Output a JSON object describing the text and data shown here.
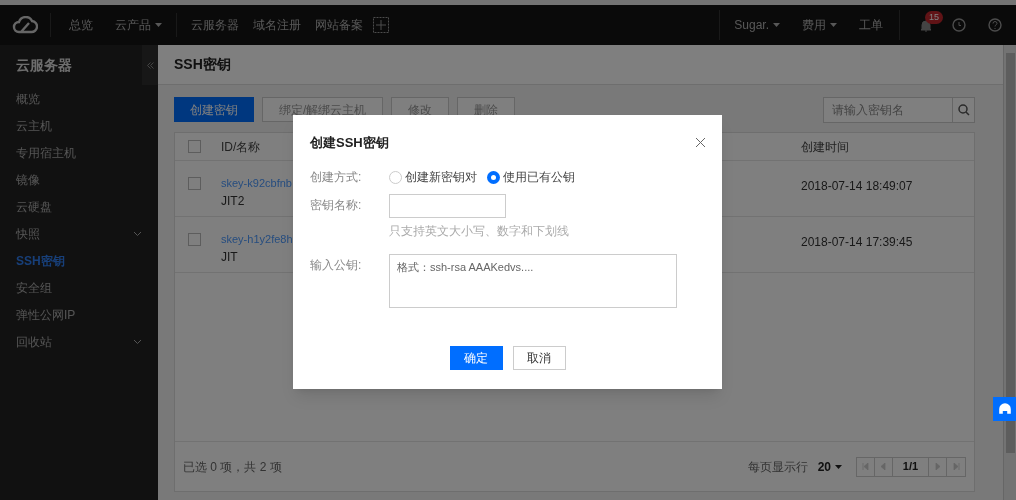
{
  "topnav": {
    "left": [
      {
        "label": "总览",
        "dropdown": false
      },
      {
        "label": "云产品",
        "dropdown": true
      }
    ],
    "shortcuts": [
      "云服务器",
      "域名注册",
      "网站备案"
    ],
    "right": [
      {
        "label": "Sugar.",
        "dropdown": true
      },
      {
        "label": "费用",
        "dropdown": true
      },
      {
        "label": "工单",
        "dropdown": false
      }
    ],
    "notification_count": "15"
  },
  "sidebar": {
    "title": "云服务器",
    "items": [
      {
        "label": "概览",
        "selected": false,
        "expandable": false
      },
      {
        "label": "云主机",
        "selected": false,
        "expandable": false
      },
      {
        "label": "专用宿主机",
        "selected": false,
        "expandable": false
      },
      {
        "label": "镜像",
        "selected": false,
        "expandable": false
      },
      {
        "label": "云硬盘",
        "selected": false,
        "expandable": false
      },
      {
        "label": "快照",
        "selected": false,
        "expandable": true
      },
      {
        "label": "SSH密钥",
        "selected": true,
        "expandable": false
      },
      {
        "label": "安全组",
        "selected": false,
        "expandable": false
      },
      {
        "label": "弹性公网IP",
        "selected": false,
        "expandable": false
      },
      {
        "label": "回收站",
        "selected": false,
        "expandable": true
      }
    ]
  },
  "page_title": "SSH密钥",
  "toolbar": [
    {
      "label": "创建密钥",
      "primary": true
    },
    {
      "label": "绑定/解绑云主机",
      "primary": false
    },
    {
      "label": "修改",
      "primary": false
    },
    {
      "label": "删除",
      "primary": false
    }
  ],
  "search": {
    "placeholder": "请输入密钥名"
  },
  "table": {
    "select_all_checked": false,
    "columns": [
      "ID/名称",
      "创建时间"
    ],
    "rows": [
      {
        "id": "skey-k92cbfnb",
        "name": "JIT2",
        "created": "2018-07-14 18:49:07",
        "checked": false
      },
      {
        "id": "skey-h1y2fe8h",
        "name": "JIT",
        "created": "2018-07-14 17:39:45",
        "checked": false
      }
    ]
  },
  "footer": {
    "summary": "已选 0 项，共 2 项",
    "page_size_label": "每页显示行",
    "page_size": "20",
    "page": "1/1"
  },
  "dialog": {
    "title": "创建SSH密钥",
    "method_label": "创建方式:",
    "methods": [
      {
        "label": "创建新密钥对",
        "selected": false
      },
      {
        "label": "使用已有公钥",
        "selected": true
      }
    ],
    "name_label": "密钥名称:",
    "name_hint": "只支持英文大小写、数字和下划线",
    "key_label": "输入公钥:",
    "key_placeholder": "格式：ssh-rsa AAAKedvs....",
    "confirm": "确定",
    "cancel": "取消"
  }
}
